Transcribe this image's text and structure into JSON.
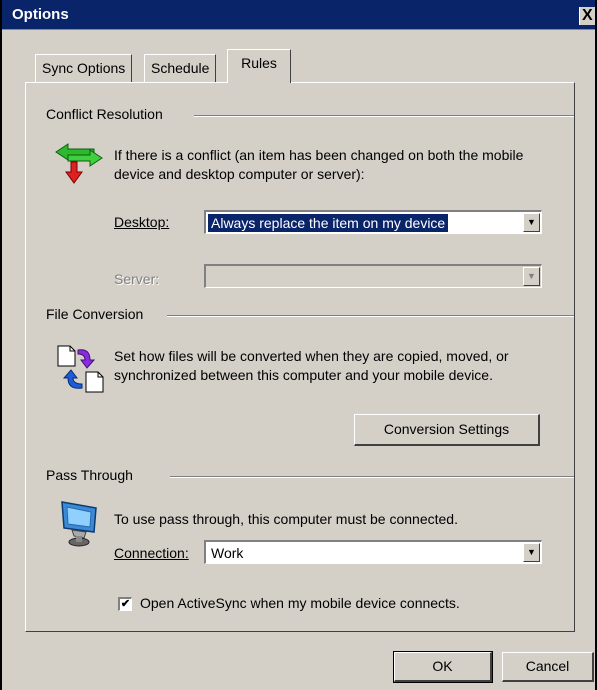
{
  "window": {
    "title": "Options",
    "close_glyph": "X"
  },
  "tabs": [
    {
      "label": "Sync Options",
      "active": false
    },
    {
      "label": "Schedule",
      "active": false
    },
    {
      "label": "Rules",
      "active": true
    }
  ],
  "conflict": {
    "title": "Conflict Resolution",
    "description": "If there is a conflict (an item has been changed on both the mobile device and desktop computer or server):",
    "desktop_label": "Desktop:",
    "desktop_value": "Always replace the item on my device",
    "server_label": "Server:",
    "server_value": "",
    "icon": "conflict-arrows-icon"
  },
  "file_conversion": {
    "title": "File Conversion",
    "description": "Set how files will be converted when they are copied, moved, or synchronized between this computer and your mobile device.",
    "button_label": "Conversion Settings",
    "icon": "file-conversion-icon"
  },
  "pass_through": {
    "title": "Pass Through",
    "description": "To use pass through, this computer must be connected.",
    "connection_label": "Connection:",
    "connection_value": "Work",
    "checkbox_label": "Open ActiveSync when my mobile device connects.",
    "checkbox_checked": true,
    "icon": "network-computer-icon"
  },
  "footer": {
    "ok_label": "OK",
    "cancel_label": "Cancel"
  },
  "colors": {
    "titlebar": "#0a246a",
    "face": "#d4d0c8",
    "selection": "#0a246a"
  }
}
